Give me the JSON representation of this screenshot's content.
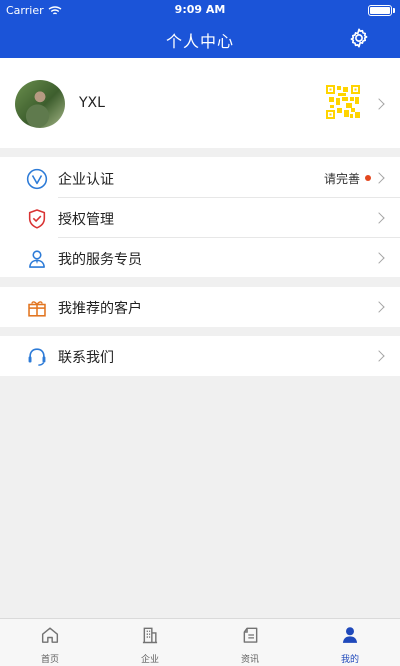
{
  "status_bar": {
    "carrier": "Carrier",
    "time": "9:09 AM"
  },
  "header": {
    "title": "个人中心",
    "settings_icon": "settings-gear-icon"
  },
  "profile": {
    "name": "YXL",
    "avatar_icon": "profile-photo",
    "qr_icon": "qr-code-icon"
  },
  "menu": {
    "certification": {
      "label": "企业认证",
      "status": "请完善",
      "status_color": "#e3471e"
    },
    "authorization": {
      "label": "授权管理"
    },
    "service_specialist": {
      "label": "我的服务专员"
    },
    "recommended_customers": {
      "label": "我推荐的客户"
    },
    "contact": {
      "label": "联系我们"
    }
  },
  "tabs": [
    {
      "label": "首页",
      "icon": "home-icon"
    },
    {
      "label": "企业",
      "icon": "building-icon"
    },
    {
      "label": "资讯",
      "icon": "news-icon"
    },
    {
      "label": "我的",
      "icon": "profile-icon",
      "active": true
    }
  ],
  "colors": {
    "header_blue": "#1b54d8",
    "tab_active": "#1f49bb",
    "qr_yellow": "#ffd400"
  }
}
